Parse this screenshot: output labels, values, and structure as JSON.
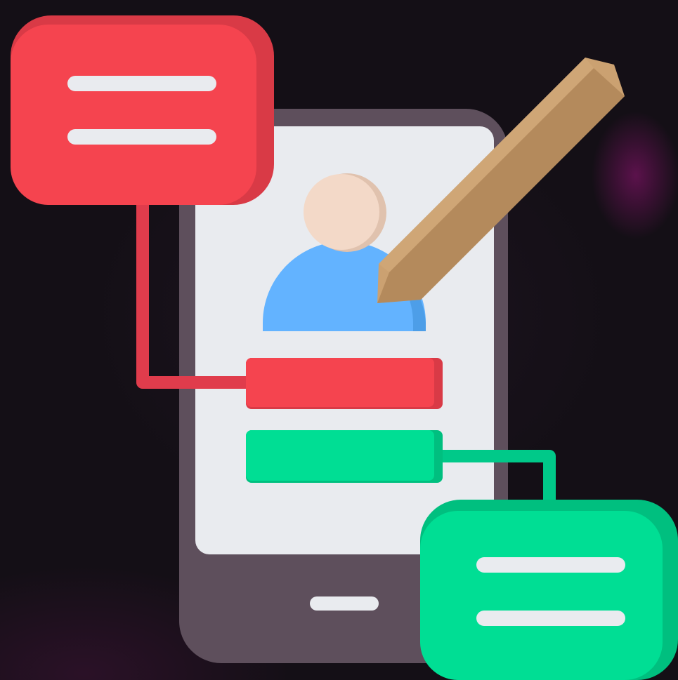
{
  "illustration": {
    "subject": "mobile-app-form-editing-icon",
    "colors": {
      "background": "#140f16",
      "phone_body": "#5e4f5c",
      "phone_screen": "#e9ebef",
      "home_button": "#e9ebef",
      "red_accent": "#f5444f",
      "red_shadow": "#d93a46",
      "green_accent": "#00de94",
      "green_shadow": "#00bf7f",
      "avatar_head": "#f3d9c8",
      "avatar_head_shadow": "#e0c2ae",
      "avatar_body": "#63b3ff",
      "avatar_body_shadow": "#4d9ee8",
      "pencil_light": "#cba171",
      "pencil_dark": "#b48a5c",
      "bubble_lines": "#e9ebef"
    },
    "icons": [
      "smartphone-icon",
      "user-avatar-icon",
      "pencil-icon",
      "red-speech-card-icon",
      "green-speech-card-icon"
    ]
  }
}
